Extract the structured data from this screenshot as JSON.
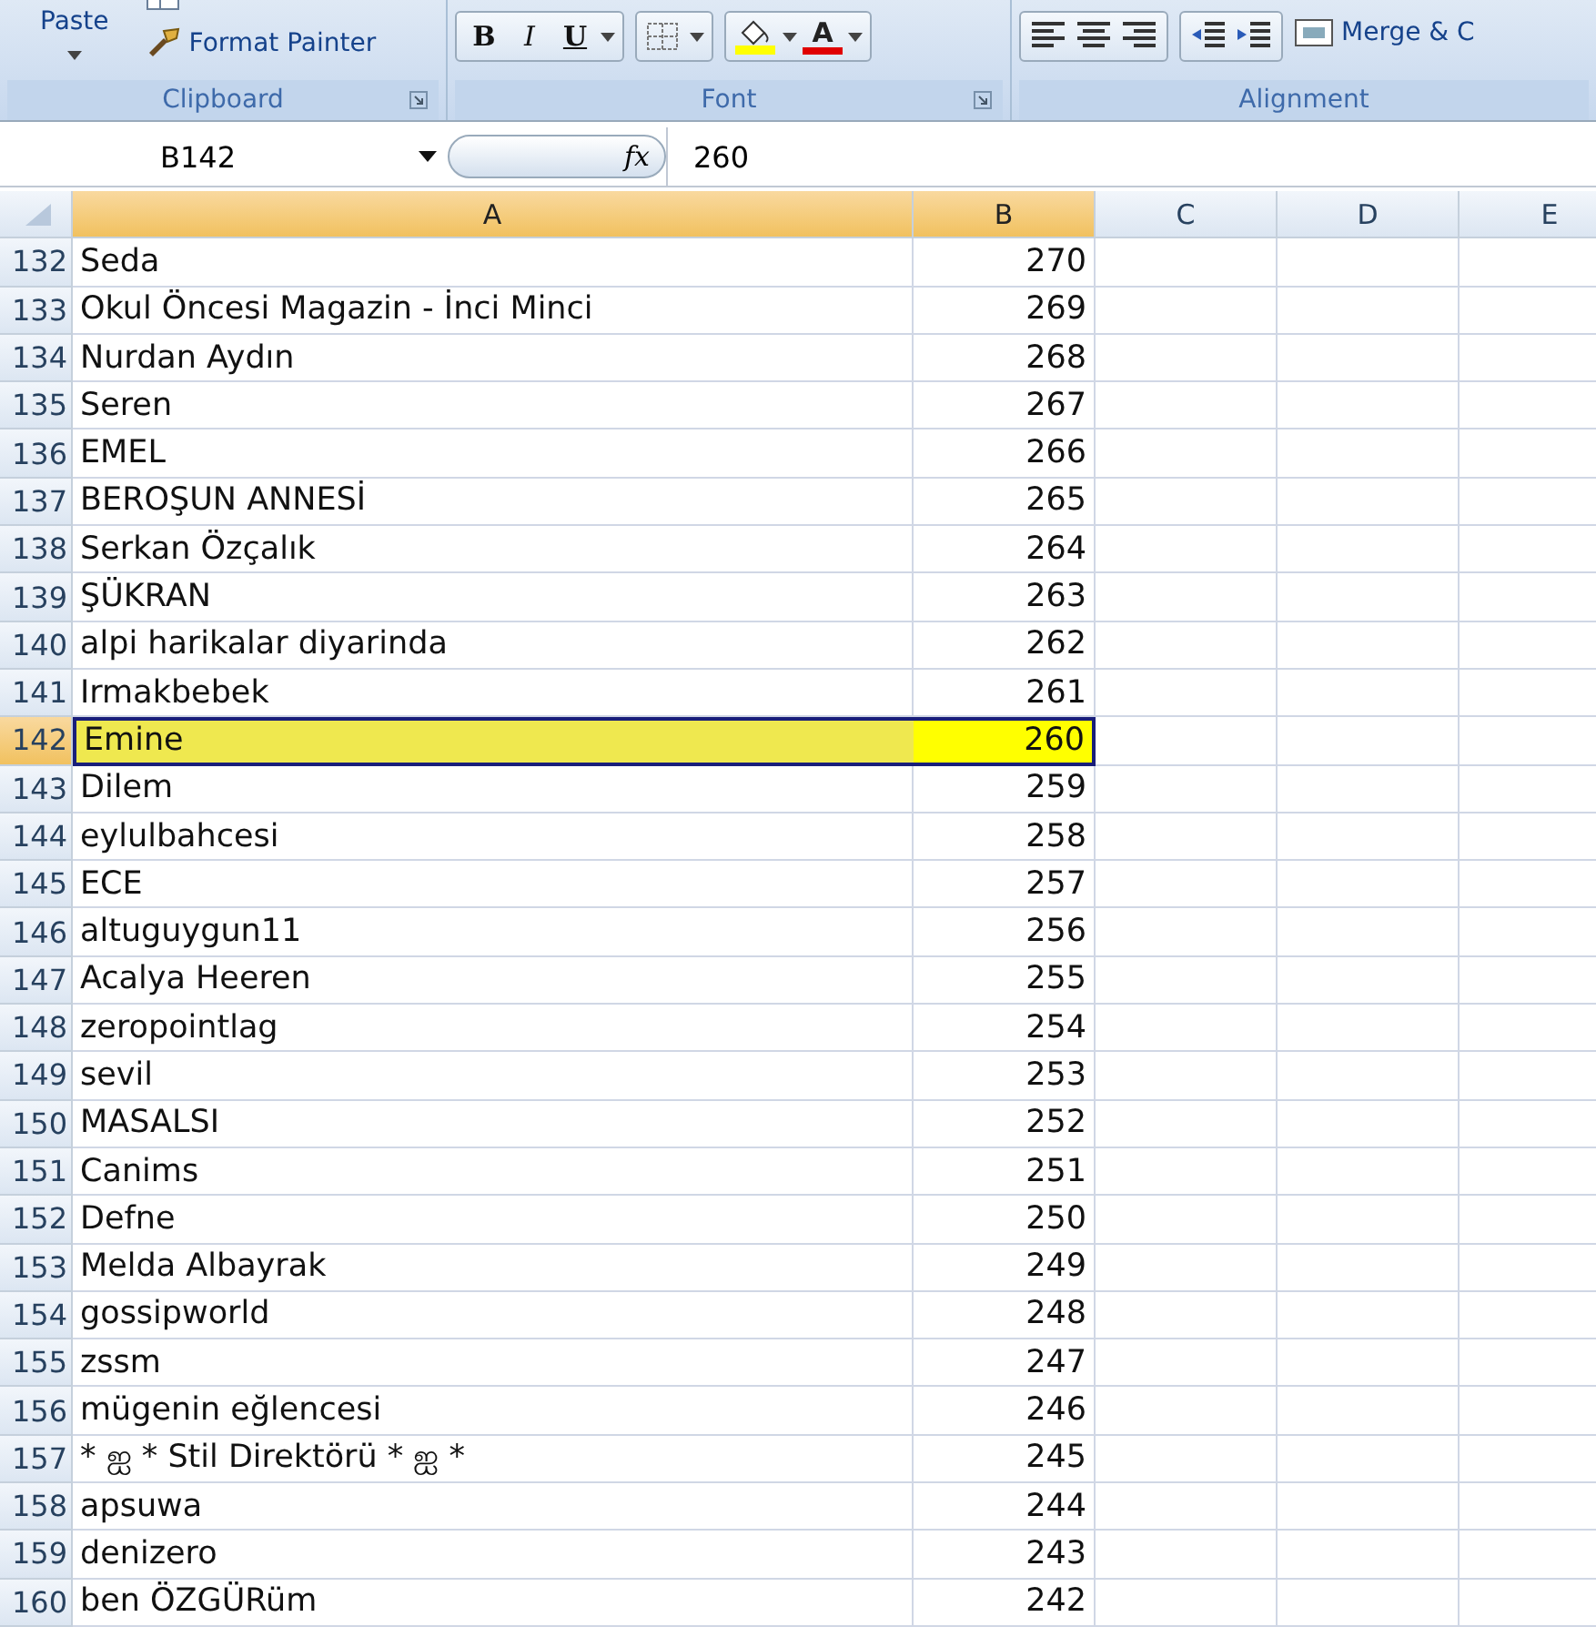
{
  "ribbon": {
    "groups": [
      {
        "kind": "clipboard",
        "label": "Clipboard",
        "paste": "Paste",
        "format_painter": "Format Painter"
      },
      {
        "kind": "font",
        "label": "Font",
        "bold": "B",
        "italic": "I",
        "underline": "U",
        "font_color": "A"
      },
      {
        "kind": "alignment",
        "label": "Alignment",
        "merge": "Merge & C"
      }
    ]
  },
  "formula_bar": {
    "name_box": "B142",
    "function_label": "fx",
    "value": "260"
  },
  "columns": [
    {
      "label": "A",
      "selected": true
    },
    {
      "label": "B",
      "selected": true
    },
    {
      "label": "C",
      "selected": false
    },
    {
      "label": "D",
      "selected": false
    },
    {
      "label": "E",
      "selected": false
    }
  ],
  "rows": [
    {
      "number": "132",
      "a": "Seda",
      "b": "270",
      "selected": false
    },
    {
      "number": "133",
      "a": "Okul Öncesi Magazin - İnci Minci",
      "b": "269",
      "selected": false
    },
    {
      "number": "134",
      "a": "Nurdan Aydın",
      "b": "268",
      "selected": false
    },
    {
      "number": "135",
      "a": "Seren",
      "b": "267",
      "selected": false
    },
    {
      "number": "136",
      "a": "EMEL",
      "b": "266",
      "selected": false
    },
    {
      "number": "137",
      "a": "BEROŞUN ANNESİ",
      "b": "265",
      "selected": false
    },
    {
      "number": "138",
      "a": "Serkan Özçalık",
      "b": "264",
      "selected": false
    },
    {
      "number": "139",
      "a": "ŞÜKRAN",
      "b": "263",
      "selected": false
    },
    {
      "number": "140",
      "a": "alpi harikalar diyarinda",
      "b": "262",
      "selected": false
    },
    {
      "number": "141",
      "a": "Irmakbebek",
      "b": "261",
      "selected": false
    },
    {
      "number": "142",
      "a": "Emine",
      "b": "260",
      "selected": true
    },
    {
      "number": "143",
      "a": "Dilem",
      "b": "259",
      "selected": false
    },
    {
      "number": "144",
      "a": "eylulbahcesi",
      "b": "258",
      "selected": false
    },
    {
      "number": "145",
      "a": "ECE",
      "b": "257",
      "selected": false
    },
    {
      "number": "146",
      "a": "altuguygun11",
      "b": "256",
      "selected": false
    },
    {
      "number": "147",
      "a": "Acalya Heeren",
      "b": "255",
      "selected": false
    },
    {
      "number": "148",
      "a": "zeropointlag",
      "b": "254",
      "selected": false
    },
    {
      "number": "149",
      "a": "sevil",
      "b": "253",
      "selected": false
    },
    {
      "number": "150",
      "a": "MASALSI",
      "b": "252",
      "selected": false
    },
    {
      "number": "151",
      "a": "Canims",
      "b": "251",
      "selected": false
    },
    {
      "number": "152",
      "a": "Defne",
      "b": "250",
      "selected": false
    },
    {
      "number": "153",
      "a": "Melda Albayrak",
      "b": "249",
      "selected": false
    },
    {
      "number": "154",
      "a": "gossipworld",
      "b": "248",
      "selected": false
    },
    {
      "number": "155",
      "a": "zssm",
      "b": "247",
      "selected": false
    },
    {
      "number": "156",
      "a": "mügenin eğlencesi",
      "b": "246",
      "selected": false
    },
    {
      "number": "157",
      "a": "* ஐ * Stil Direktörü * ஐ *",
      "b": "245",
      "selected": false
    },
    {
      "number": "158",
      "a": "apsuwa",
      "b": "244",
      "selected": false
    },
    {
      "number": "159",
      "a": "denizero",
      "b": "243",
      "selected": false
    },
    {
      "number": "160",
      "a": "ben ÖZGÜRüm",
      "b": "242",
      "selected": false
    }
  ]
}
